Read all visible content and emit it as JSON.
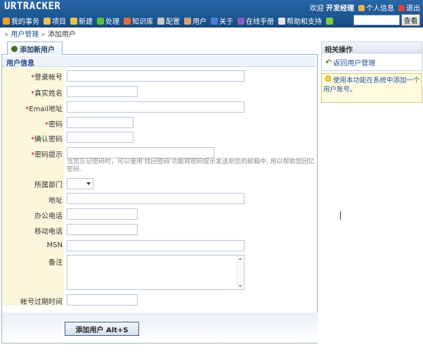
{
  "header": {
    "logo": "URTRACKER",
    "welcome": "欢迎",
    "user": "开发经理",
    "profile": "个人信息",
    "logout": "退出"
  },
  "nav": {
    "items": [
      {
        "label": "我的事务",
        "icon": "home-icon",
        "color": "#f0a020"
      },
      {
        "label": "项目",
        "icon": "database-icon",
        "color": "#f2c04a"
      },
      {
        "label": "新建",
        "icon": "new-icon",
        "color": "#e8c24b"
      },
      {
        "label": "处理",
        "icon": "check-icon",
        "color": "#5bbf3a"
      },
      {
        "label": "知识库",
        "icon": "book-icon",
        "color": "#e86a3c"
      },
      {
        "label": "配置",
        "icon": "gear-icon",
        "color": "#c9c9c9"
      },
      {
        "label": "用户",
        "icon": "users-icon",
        "color": "#d8a070"
      },
      {
        "label": "关于",
        "icon": "info-icon",
        "color": "#4a7fd1"
      },
      {
        "label": "在线手册",
        "icon": "manual-icon",
        "color": "#8a5fc2"
      },
      {
        "label": "帮助和支持",
        "icon": "help-icon",
        "color": "#e4e4e4"
      },
      {
        "label": "",
        "icon": "star-icon",
        "color": "#7ccf3c"
      }
    ],
    "search_button": "查看",
    "search_value": ""
  },
  "breadcrumb": {
    "prefix": "»",
    "parent": "用户管理",
    "sep": "»",
    "current": "添加用户"
  },
  "tab": {
    "label": "添加新用户"
  },
  "form": {
    "section_title": "用户信息",
    "fields": {
      "login": {
        "label": "登录帐号",
        "required": true,
        "value": ""
      },
      "realname": {
        "label": "真实姓名",
        "required": true,
        "value": ""
      },
      "email": {
        "label": "Email地址",
        "required": true,
        "value": ""
      },
      "password": {
        "label": "密码",
        "required": true,
        "value": ""
      },
      "confirm": {
        "label": "确认密码",
        "required": true,
        "value": ""
      },
      "hint": {
        "label": "密码提示",
        "required": true,
        "value": ""
      },
      "dept": {
        "label": "所属部门",
        "required": false,
        "value": ""
      },
      "address": {
        "label": "地址",
        "required": false,
        "value": ""
      },
      "office_phone": {
        "label": "办公电话",
        "required": false,
        "value": ""
      },
      "mobile": {
        "label": "移动电话",
        "required": false,
        "value": ""
      },
      "msn": {
        "label": "MSN",
        "required": false,
        "value": ""
      },
      "remark": {
        "label": "备注",
        "required": false,
        "value": ""
      },
      "expire": {
        "label": "帐号过期时间",
        "required": false,
        "value": ""
      }
    },
    "hint_text": "当您忘记密码时，可以使用'找回密码'功能将密码提示发送到您的邮箱中. 用以帮助您回忆密码.",
    "required_mark": "*",
    "submit": "添加用户  Alt+S"
  },
  "sidebar": {
    "title": "相关操作",
    "back_link": "返回用户管理",
    "tip": "使用本功能在系统中添加一个用户账号。"
  }
}
